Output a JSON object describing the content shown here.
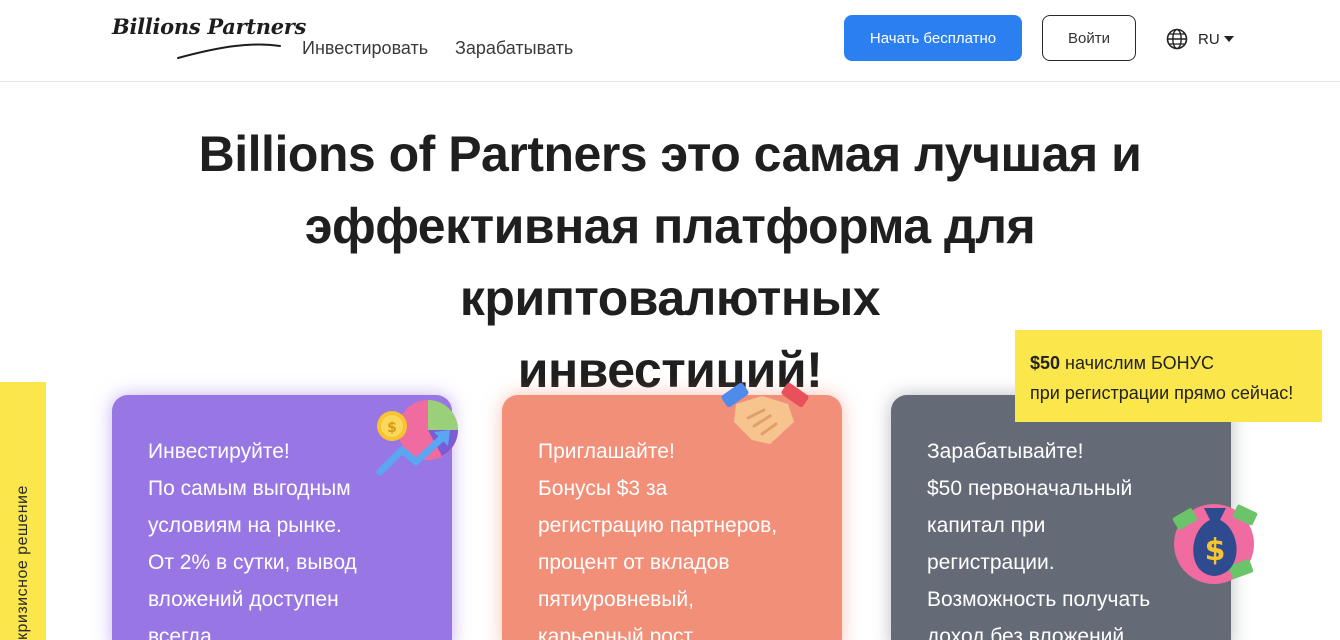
{
  "header": {
    "logo_text": "Billions Partners",
    "nav": {
      "invest": "Инвестировать",
      "earn": "Зарабатывать"
    },
    "start_button": "Начать бесплатно",
    "login_button": "Войти",
    "language": "RU"
  },
  "hero": {
    "title_lines": [
      "Billions of Partners это самая лучшая и",
      "эффективная платформа для криптовалютных",
      "инвестиций!"
    ]
  },
  "side_tab": {
    "label": "кризисное решение"
  },
  "bonus": {
    "amount": "$50",
    "line1_rest": " начислим БОНУС",
    "line2": "при регистрации прямо сейчас!"
  },
  "cards": [
    {
      "lines": [
        "Инвестируйте!",
        "По самым выгодным",
        "условиям на рынке.",
        "От 2% в сутки, вывод",
        "вложений доступен",
        "всегда."
      ]
    },
    {
      "lines": [
        "Приглашайте!",
        "Бонусы $3 за",
        "регистрацию партнеров,",
        "процент от вкладов",
        "пятиуровневый,",
        "карьерный рост."
      ]
    },
    {
      "lines": [
        "Зарабатывайте!",
        "$50 первоначальный",
        "капитал при",
        "регистрации.",
        "Возможность получать",
        "доход без вложений."
      ]
    }
  ],
  "icons": {
    "globe": "globe-icon",
    "caret": "caret-down-icon",
    "card1": "investment-chart-icon",
    "card2": "handshake-icon",
    "card3": "money-bag-icon"
  },
  "colors": {
    "accent_blue": "#2b7ff0",
    "yellow": "#fbe64c",
    "card_purple": "#9876e4",
    "card_salmon": "#f28f78",
    "card_gray": "#646b77"
  }
}
